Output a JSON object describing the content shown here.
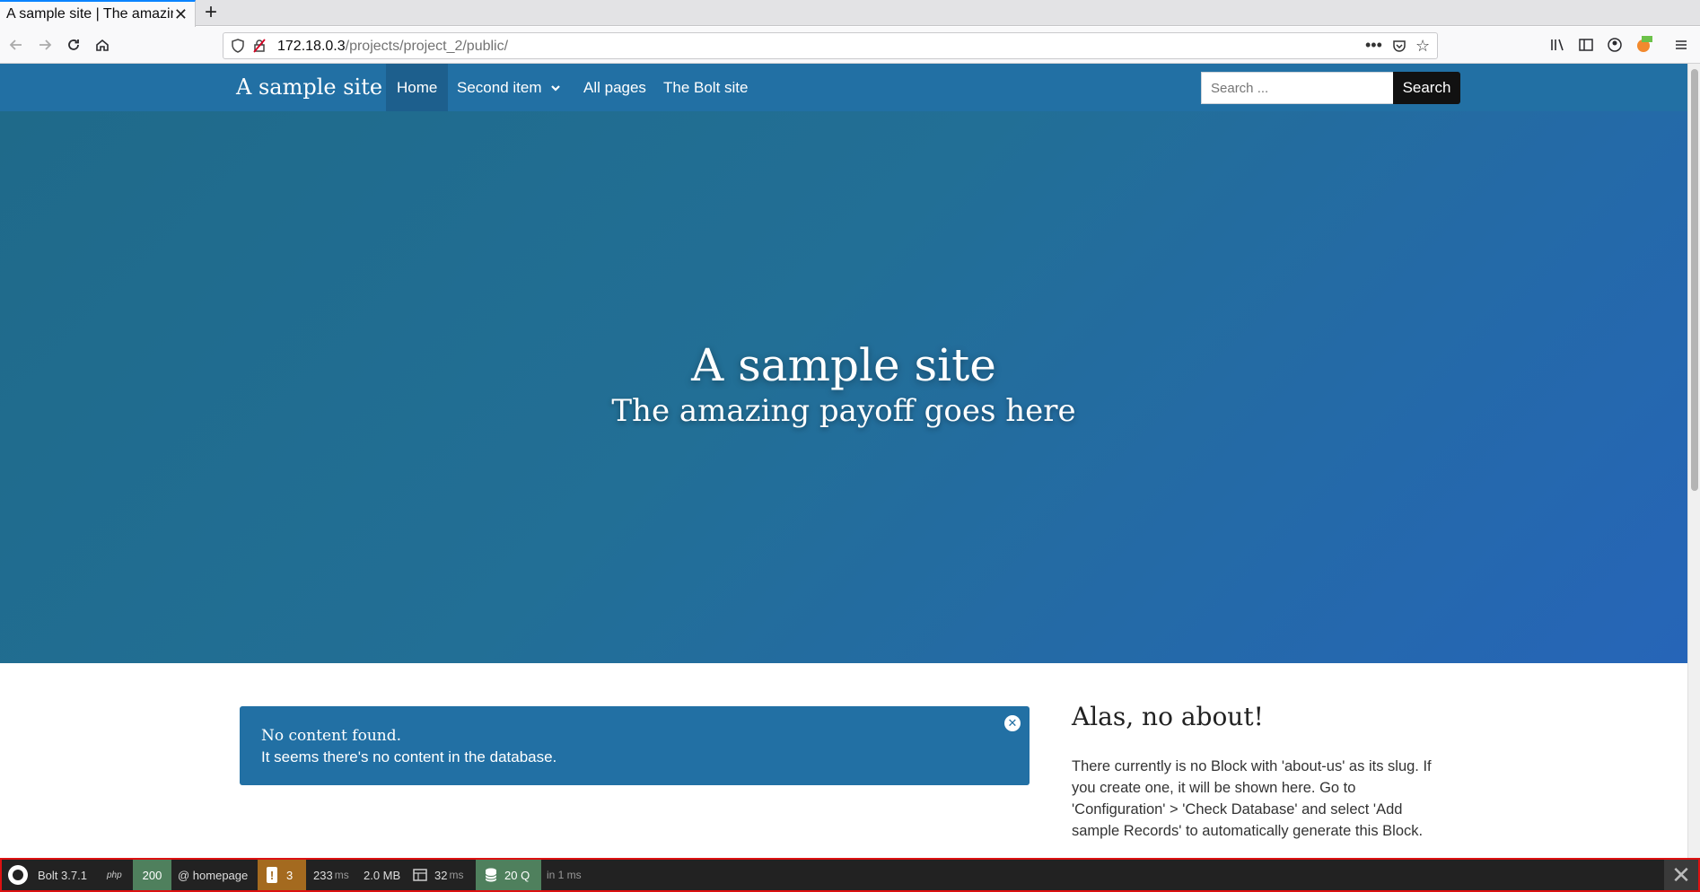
{
  "browser": {
    "tab_title": "A sample site | The amazing payoff goes here",
    "url_host": "172.18.0.3",
    "url_path": "/projects/project_2/public/"
  },
  "site": {
    "brand": "A sample site",
    "nav": [
      {
        "label": "Home",
        "active": true
      },
      {
        "label": "Second item",
        "dropdown": true
      },
      {
        "label": "All pages"
      },
      {
        "label": "The Bolt site"
      }
    ],
    "search_placeholder": "Search ...",
    "search_button": "Search"
  },
  "hero": {
    "title": "A sample site",
    "subtitle": "The amazing payoff goes here"
  },
  "alert": {
    "line1": "No content found.",
    "line2": "It seems there's no content in the database."
  },
  "aside": {
    "title": "Alas, no about!",
    "text": "There currently is no Block with 'about-us' as its slug. If you create one, it will be shown here. Go to 'Configuration' > 'Check Database' and select 'Add sample Records' to automatically generate this Block."
  },
  "debugbar": {
    "version": "Bolt 3.7.1",
    "php": "php",
    "status": "200",
    "route": "@ homepage",
    "warnings": "3",
    "time_value": "233",
    "time_unit": "ms",
    "memory": "2.0 MB",
    "render_value": "32",
    "render_unit": "ms",
    "queries": "20 Q",
    "queries_time": "in 1 ms"
  }
}
